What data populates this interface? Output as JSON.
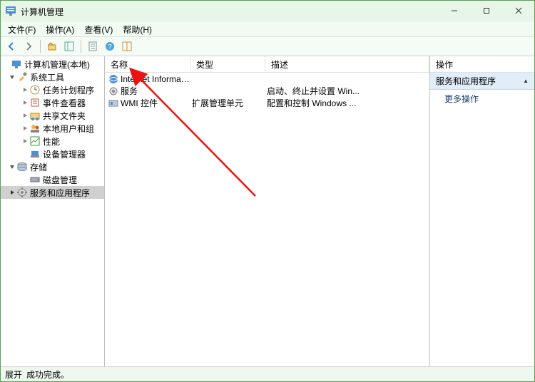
{
  "window": {
    "title": "计算机管理"
  },
  "menubar": [
    "文件(F)",
    "操作(A)",
    "查看(V)",
    "帮助(H)"
  ],
  "tree": {
    "root": "计算机管理(本地)",
    "system_tools": {
      "label": "系统工具",
      "children": [
        "任务计划程序",
        "事件查看器",
        "共享文件夹",
        "本地用户和组",
        "性能",
        "设备管理器"
      ]
    },
    "storage": {
      "label": "存储",
      "children": [
        "磁盘管理"
      ]
    },
    "services_apps": {
      "label": "服务和应用程序"
    }
  },
  "list": {
    "columns": {
      "name": "名称",
      "type": "类型",
      "desc": "描述"
    },
    "rows": [
      {
        "name": "Internet Information...",
        "type": "",
        "desc": ""
      },
      {
        "name": "服务",
        "type": "",
        "desc": "启动、终止并设置 Win..."
      },
      {
        "name": "WMI 控件",
        "type": "扩展管理单元",
        "desc": "配置和控制 Windows ..."
      }
    ]
  },
  "actions": {
    "title": "操作",
    "section": "服务和应用程序",
    "items": [
      "更多操作"
    ]
  },
  "statusbar": {
    "label": "展开",
    "text": "成功完成。"
  }
}
